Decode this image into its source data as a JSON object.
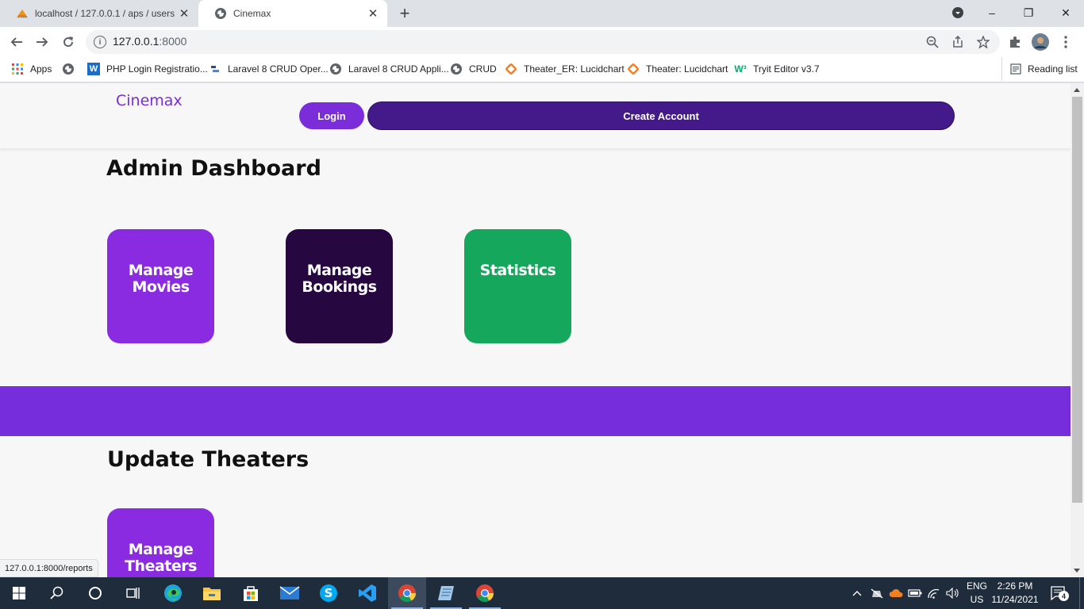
{
  "browser": {
    "tabs": [
      {
        "title": "localhost / 127.0.0.1 / aps / users |",
        "close": "✕"
      },
      {
        "title": "Cinemax",
        "close": "✕"
      }
    ],
    "new_tab": "+",
    "window_controls": {
      "minimize": "–",
      "restore": "❐",
      "close": "✕"
    },
    "url_host": "127.0.0.1",
    "url_port": ":8000",
    "bookmarks": [
      {
        "label": "Apps",
        "icon": "apps-grid-icon"
      },
      {
        "label": "",
        "icon": "globe-icon"
      },
      {
        "label": "PHP Login Registratio...",
        "icon": "w-icon"
      },
      {
        "label": "Laravel 8 CRUD Oper...",
        "icon": "site-icon"
      },
      {
        "label": "Laravel 8 CRUD Appli...",
        "icon": "globe-icon"
      },
      {
        "label": "CRUD",
        "icon": "globe-icon"
      },
      {
        "label": "Theater_ER: Lucidchart",
        "icon": "lucidchart-icon"
      },
      {
        "label": "Theater: Lucidchart",
        "icon": "lucidchart-icon"
      },
      {
        "label": "Tryit Editor v3.7",
        "icon": "w3-icon"
      }
    ],
    "reading_list": "Reading list",
    "status_url": "127.0.0.1:8000/reports"
  },
  "site": {
    "brand": "Cinemax",
    "login": "Login",
    "create_account": "Create Account",
    "dashboard_title": "Admin Dashboard",
    "tiles": [
      {
        "line1": "Manage",
        "line2": "Movies"
      },
      {
        "line1": "Manage",
        "line2": "Bookings"
      },
      {
        "line1": "Statistics",
        "line2": ""
      }
    ],
    "theaters_title": "Update Theaters",
    "theater_tile": {
      "line1": "Manage",
      "line2": "Theaters"
    }
  },
  "taskbar": {
    "lang": {
      "line1": "ENG",
      "line2": "US"
    },
    "time": "2:26 PM",
    "date": "11/24/2021",
    "notifications": "4"
  },
  "colors": {
    "brand_purple": "#7a2dd9",
    "dark_purple": "#441a8a",
    "bookings_tile": "#260740",
    "stats_tile": "#15a85c",
    "band": "#762ddb"
  }
}
